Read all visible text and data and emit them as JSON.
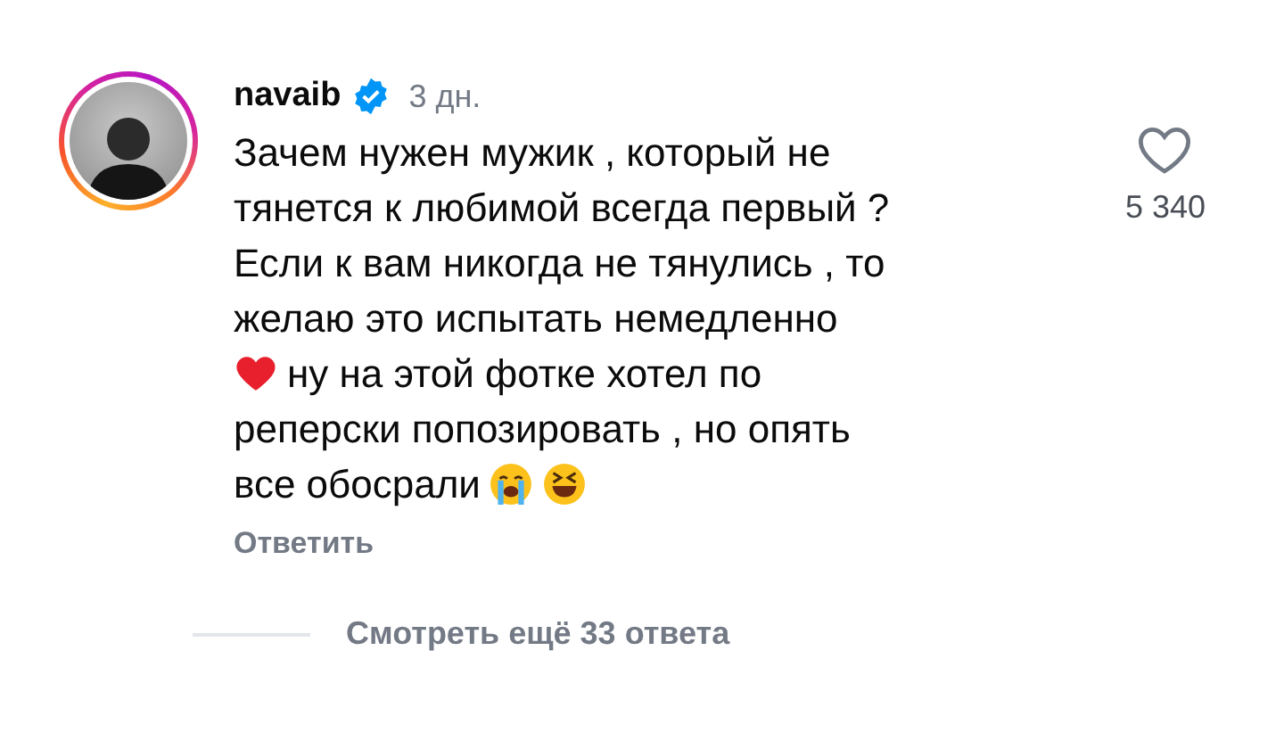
{
  "comment": {
    "username": "navaib",
    "verified": true,
    "time": "3 дн.",
    "lines": [
      [
        {
          "kind": "text",
          "text": "Зачем нужен мужик , который не"
        }
      ],
      [
        {
          "kind": "text",
          "text": "тянется к любимой всегда первый ?"
        }
      ],
      [
        {
          "kind": "text",
          "text": "Если к вам никогда не тянулись , то"
        }
      ],
      [
        {
          "kind": "text",
          "text": "желаю это испытать немедленно"
        }
      ],
      [
        {
          "kind": "heart"
        },
        {
          "kind": "text",
          "text": "ну на этой фотке хотел по"
        }
      ],
      [
        {
          "kind": "text",
          "text": "реперски попозировать , но опять"
        }
      ],
      [
        {
          "kind": "text",
          "text": "все обосрали"
        },
        {
          "kind": "crying"
        },
        {
          "kind": "laughing"
        }
      ]
    ],
    "liked": false,
    "like_count": "5 340",
    "reply_label": "Ответить"
  },
  "more_replies": "Смотреть ещё 33 ответа"
}
